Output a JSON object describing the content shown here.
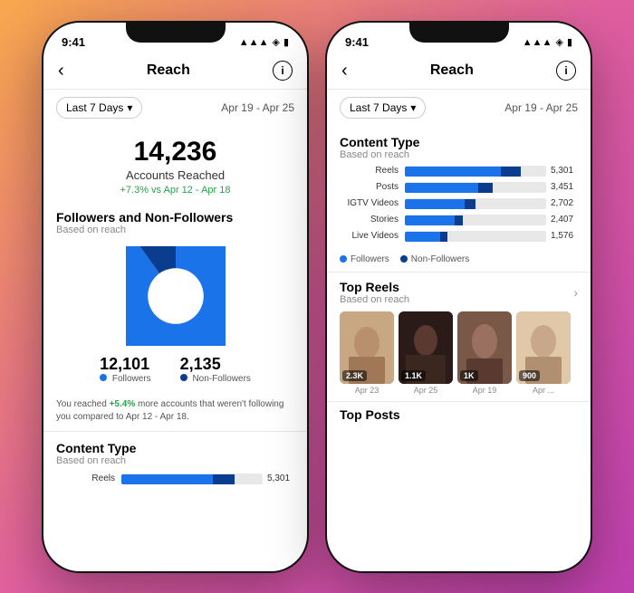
{
  "app": {
    "title": "Reach"
  },
  "status_bar": {
    "time": "9:41",
    "signal": "●●●",
    "wifi": "wifi",
    "battery": "battery"
  },
  "nav": {
    "back": "‹",
    "title": "Reach",
    "info": "i"
  },
  "filter": {
    "period": "Last 7 Days",
    "date_range": "Apr 19 - Apr 25"
  },
  "left_phone": {
    "reach": {
      "number": "14,236",
      "label": "Accounts Reached",
      "change": "+7.3% vs Apr 12 - Apr 18"
    },
    "followers_section": {
      "title": "Followers and Non-Followers",
      "subtitle": "Based on reach",
      "followers_count": "12,101",
      "followers_label": "Followers",
      "nonfollowers_count": "2,135",
      "nonfollowers_label": "Non-Followers",
      "note": "You reached +5.4% more accounts that weren't following you compared to Apr 12 - Apr 18."
    },
    "content_type": {
      "title": "Content Type",
      "subtitle": "Based on reach"
    },
    "bars": [
      {
        "label": "Reels",
        "value": "5,301",
        "followers_pct": 65,
        "nonfollowers_pct": 15
      }
    ]
  },
  "right_phone": {
    "content_type": {
      "title": "Content Type",
      "subtitle": "Based on reach",
      "bars": [
        {
          "label": "Reels",
          "value": "5,301",
          "followers_pct": 68,
          "nonfollowers_pct": 14
        },
        {
          "label": "Posts",
          "value": "3,451",
          "followers_pct": 52,
          "nonfollowers_pct": 10
        },
        {
          "label": "IGTV Videos",
          "value": "2,702",
          "followers_pct": 42,
          "nonfollowers_pct": 8
        },
        {
          "label": "Stories",
          "value": "2,407",
          "followers_pct": 35,
          "nonfollowers_pct": 6
        },
        {
          "label": "Live Videos",
          "value": "1,576",
          "followers_pct": 25,
          "nonfollowers_pct": 5
        }
      ],
      "legend": {
        "followers": "Followers",
        "nonfollowers": "Non-Followers"
      }
    },
    "top_reels": {
      "title": "Top Reels",
      "subtitle": "Based on reach",
      "reels": [
        {
          "count": "2.3K",
          "date": "Apr 23",
          "color1": "#d4b896",
          "color2": "#c8a882"
        },
        {
          "count": "1.1K",
          "date": "Apr 25",
          "color1": "#2a1f1e",
          "color2": "#3a2828"
        },
        {
          "count": "1K",
          "date": "Apr 19",
          "color1": "#6b4c3b",
          "color2": "#4a3028"
        },
        {
          "count": "900",
          "date": "Apr ...",
          "color1": "#e8d0b8",
          "color2": "#d4b898"
        }
      ]
    },
    "top_posts": {
      "title": "Top Posts"
    }
  }
}
